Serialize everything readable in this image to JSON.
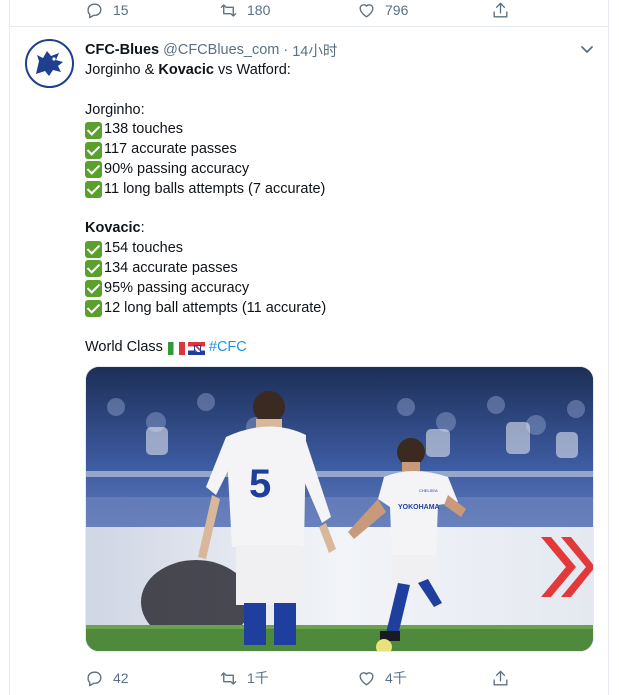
{
  "previous_tweet": {
    "actions": {
      "reply_count": "15",
      "retweet_count": "180",
      "like_count": "796"
    }
  },
  "tweet": {
    "author": {
      "name": "CFC-Blues",
      "handle": "@CFCBlues_com",
      "separator": "·",
      "time": "14小时"
    },
    "text": {
      "headline": {
        "part1": "Jorginho & ",
        "part2": "Kovacic",
        "part3": " vs Watford:"
      },
      "jorginho_title": "Jorginho:",
      "jorginho_stats": [
        "138 touches",
        "117 accurate passes",
        "90% passing accuracy",
        "11 long balls attempts (7 accurate)"
      ],
      "kovacic_title": "Kovacic",
      "kovacic_colon": ":",
      "kovacic_stats": [
        "154 touches",
        "134 accurate passes",
        "95% passing accuracy",
        "12 long ball attempts (11 accurate)"
      ],
      "closing": "World Class",
      "hashtag": "#CFC"
    },
    "media": {
      "shirt_number": "5",
      "sponsor_text": "YOKOHAMA",
      "crest_text": "CHELSEA"
    },
    "actions": {
      "reply_count": "42",
      "retweet_count": "1千",
      "like_count": "4千"
    }
  },
  "colors": {
    "secondary_text": "#5b7083",
    "hashtag": "#1b95e0",
    "check_emoji": "#5aa02c",
    "divider": "#e6ecf0"
  }
}
